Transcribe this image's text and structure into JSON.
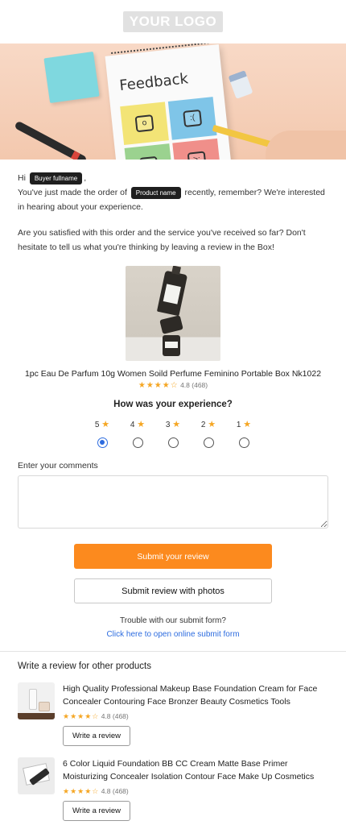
{
  "header": {
    "logo_text": "YOUR LOGO"
  },
  "hero": {
    "notepad_text": "Feedback"
  },
  "greeting": {
    "hi": "Hi",
    "buyer_tag": "Buyer fullname",
    "comma": ",",
    "line1_prefix": "You've just made the order of",
    "product_tag": "Product name",
    "line1_suffix": "recently, remember? We're interested in hearing about your experience.",
    "paragraph2": "Are you satisfied with this order and the service you've received so far? Don't hesitate to tell us what you're thinking by leaving a review in the Box!"
  },
  "product": {
    "title": "1pc Eau De Parfum 10g Women Soild Perfume Feminino Portable Box Nk1022",
    "stars": "★★★★☆",
    "rating_text": "4.8 (468)"
  },
  "experience": {
    "title": "How was your experience?",
    "options": [
      {
        "label": "5",
        "selected": true
      },
      {
        "label": "4",
        "selected": false
      },
      {
        "label": "3",
        "selected": false
      },
      {
        "label": "2",
        "selected": false
      },
      {
        "label": "1",
        "selected": false
      }
    ],
    "star_glyph": "★"
  },
  "comments": {
    "label": "Enter your comments",
    "value": ""
  },
  "buttons": {
    "submit": "Submit your review",
    "submit_photos": "Submit review with photos"
  },
  "trouble": {
    "text": "Trouble with our submit form?",
    "link": "Click here to open online submit form"
  },
  "other_products": {
    "title": "Write a review for other products",
    "items": [
      {
        "name": "High Quality Professional Makeup Base Foundation Cream for Face Concealer Contouring Face Bronzer Beauty Cosmetics Tools",
        "stars": "★★★★☆",
        "rating_text": "4.8 (468)",
        "button": "Write a review"
      },
      {
        "name": "6 Color Liquid Foundation BB CC Cream Matte Base Primer Moisturizing Concealer Isolation Contour Face Make Up Cosmetics",
        "stars": "★★★★☆",
        "rating_text": "4.8 (468)",
        "button": "Write a review"
      }
    ]
  },
  "colors": {
    "accent": "#fc8a1e",
    "link": "#2d6cdf",
    "star": "#f5a623"
  }
}
